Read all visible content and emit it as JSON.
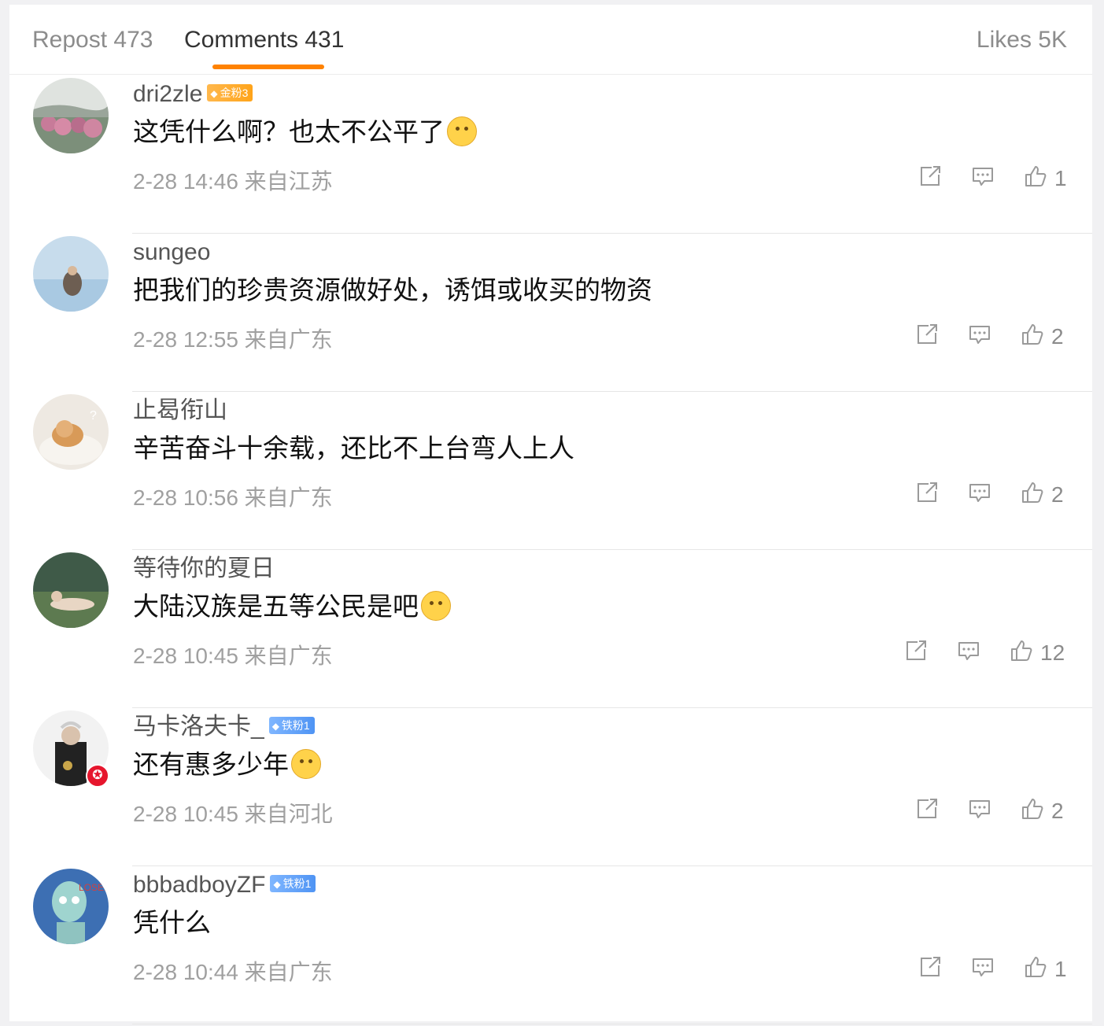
{
  "tabs": {
    "repost": "Repost 473",
    "comments": "Comments 431",
    "likes": "Likes 5K"
  },
  "colors": {
    "accent": "#ff8200",
    "gold_badge": "#ffa41a",
    "iron_badge": "#4f94f4",
    "verified_badge": "#e6162d"
  },
  "comments": [
    {
      "username": "dri2zle",
      "badge": "金粉3",
      "badge_type": "gold",
      "text": "这凭什么啊？也太不公平了",
      "emoji": "face-with-monocle",
      "time": "2-28 14:46",
      "location": "来自江苏",
      "likes": "1"
    },
    {
      "username": "sungeo",
      "text": "把我们的珍贵资源做好处，诱饵或收买的物资",
      "time": "2-28 12:55",
      "location": "来自广东",
      "likes": "2"
    },
    {
      "username": "止曷衔山",
      "text": "辛苦奋斗十余载，还比不上台弯人上人",
      "time": "2-28 10:56",
      "location": "来自广东",
      "likes": "2"
    },
    {
      "username": "等待你的夏日",
      "text": "大陆汉族是五等公民是吧",
      "emoji": "exploding-head",
      "time": "2-28 10:45",
      "location": "来自广东",
      "likes": "12"
    },
    {
      "username": "马卡洛夫卡_",
      "badge": "铁粉1",
      "badge_type": "iron",
      "text": "还有惠多少年",
      "emoji": "face-savoring-food",
      "time": "2-28 10:45",
      "location": "来自河北",
      "likes": "2"
    },
    {
      "username": "bbbadboyZF",
      "badge": "铁粉1",
      "badge_type": "iron",
      "text": "凭什么",
      "time": "2-28 10:44",
      "location": "来自广东",
      "likes": "1"
    }
  ]
}
